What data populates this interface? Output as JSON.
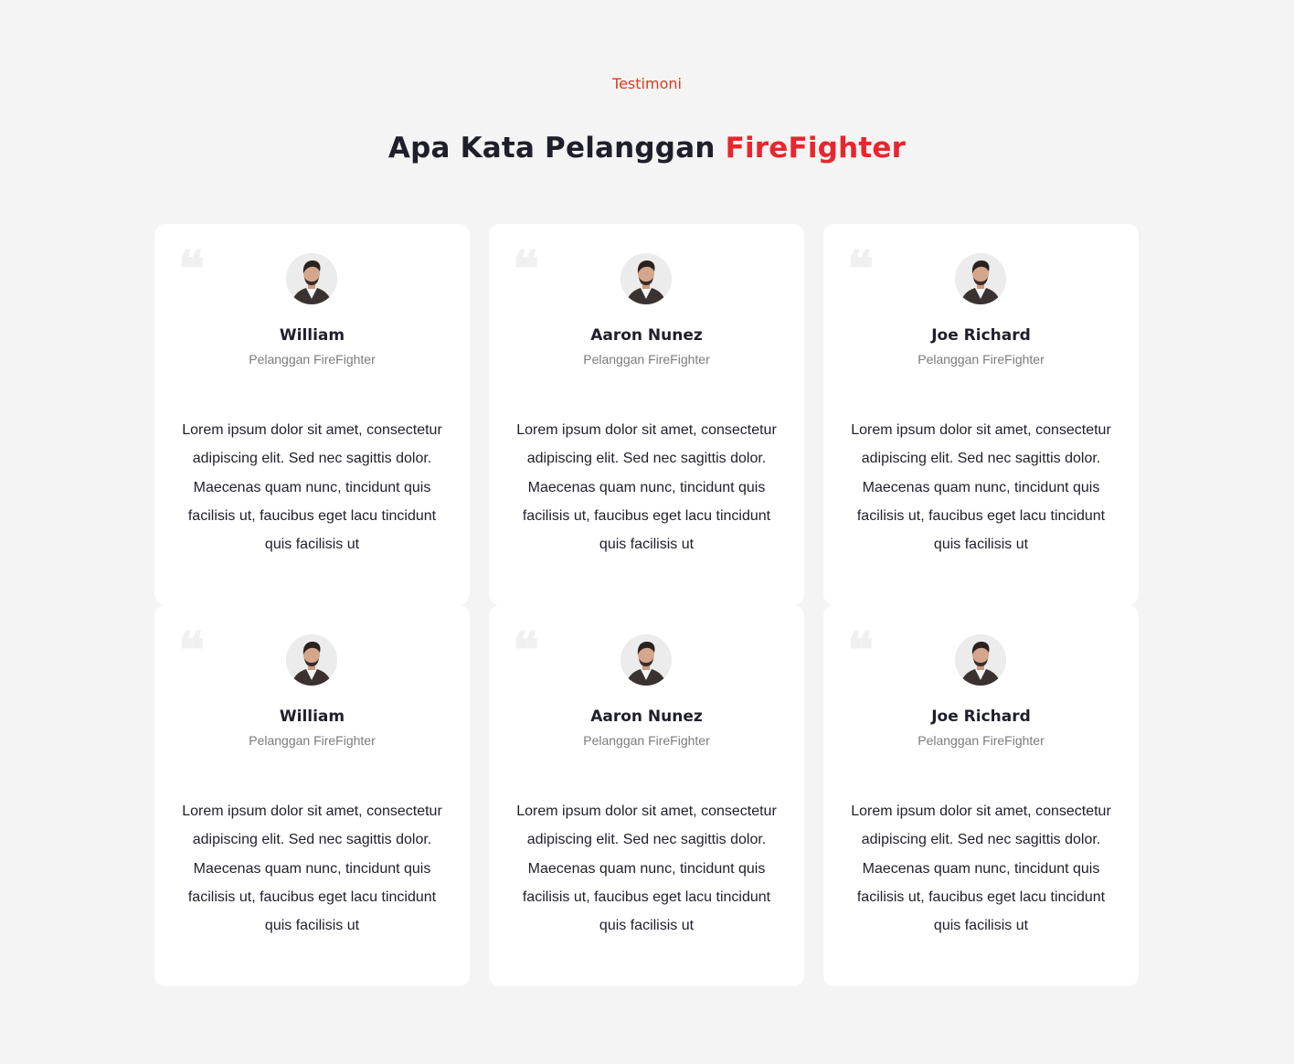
{
  "section": {
    "eyebrow": "Testimoni",
    "title_main": "Apa Kata Pelanggan",
    "title_accent": "FireFighter",
    "accent_color": "#e8262c"
  },
  "testimonials": [
    {
      "name": "William",
      "role": "Pelanggan FireFighter",
      "text": "Lorem ipsum dolor sit amet, consectetur adipiscing elit. Sed nec sagittis dolor. Maecenas quam nunc, tincidunt quis facilisis ut, faucibus eget lacu tincidunt quis facilisis ut",
      "icon": "quote-icon"
    },
    {
      "name": "Aaron Nunez",
      "role": "Pelanggan FireFighter",
      "text": "Lorem ipsum dolor sit amet, consectetur adipiscing elit. Sed nec sagittis dolor. Maecenas quam nunc, tincidunt quis facilisis ut, faucibus eget lacu tincidunt quis facilisis ut",
      "icon": "quote-icon"
    },
    {
      "name": "Joe Richard",
      "role": "Pelanggan FireFighter",
      "text": "Lorem ipsum dolor sit amet, consectetur adipiscing elit. Sed nec sagittis dolor. Maecenas quam nunc, tincidunt quis facilisis ut, faucibus eget lacu tincidunt quis facilisis ut",
      "icon": "quote-icon"
    },
    {
      "name": "William",
      "role": "Pelanggan FireFighter",
      "text": "Lorem ipsum dolor sit amet, consectetur adipiscing elit. Sed nec sagittis dolor. Maecenas quam nunc, tincidunt quis facilisis ut, faucibus eget lacu tincidunt quis facilisis ut",
      "icon": "quote-icon"
    },
    {
      "name": "Aaron Nunez",
      "role": "Pelanggan FireFighter",
      "text": "Lorem ipsum dolor sit amet, consectetur adipiscing elit. Sed nec sagittis dolor. Maecenas quam nunc, tincidunt quis facilisis ut, faucibus eget lacu tincidunt quis facilisis ut",
      "icon": "quote-icon"
    },
    {
      "name": "Joe Richard",
      "role": "Pelanggan FireFighter",
      "text": "Lorem ipsum dolor sit amet, consectetur adipiscing elit. Sed nec sagittis dolor. Maecenas quam nunc, tincidunt quis facilisis ut, faucibus eget lacu tincidunt quis facilisis ut",
      "icon": "quote-icon"
    }
  ]
}
